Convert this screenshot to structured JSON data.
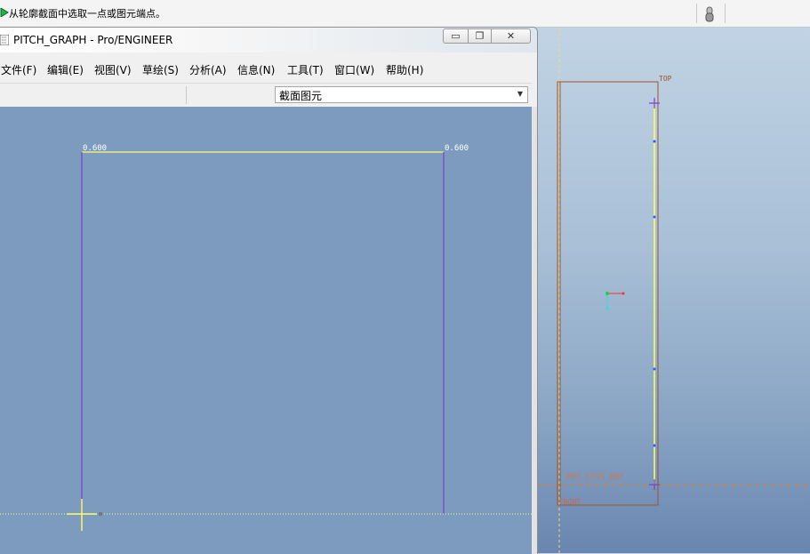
{
  "message_bar": {
    "prompt_text": "从轮廓截面中选取一点或图元端点。",
    "arrow_icon": "green-arrow-icon",
    "tool_icon": "mouse-icon"
  },
  "window": {
    "title_part1": "PITCH_GRAPH",
    "title_sep": " - ",
    "title_part2": "Pro/ENGINEER",
    "minimize_icon": "minimize-icon",
    "maximize_icon": "restore-icon",
    "close_icon": "close-icon"
  },
  "menu": [
    {
      "label": "文件(F)"
    },
    {
      "label": "编辑(E)"
    },
    {
      "label": "视图(V)"
    },
    {
      "label": "草绘(S)"
    },
    {
      "label": "分析(A)"
    },
    {
      "label": "信息(N)"
    },
    {
      "label": "工具(T)"
    },
    {
      "label": "窗口(W)"
    },
    {
      "label": "帮助(H)"
    }
  ],
  "filter": {
    "selected": "截面图元"
  },
  "sketch": {
    "dim_left": "0.600",
    "dim_right": "0.600"
  },
  "graphics": {
    "plane_label_top": "TOP",
    "csys_label": "PRT_CSYS_DEF",
    "plane_label_front": "FRONT"
  },
  "colors": {
    "sketch_bg": "#7c9bbf",
    "entity_line": "#ffff66",
    "purple_line": "#7a3fc8",
    "datum_brown": "#a0522d",
    "csys_orange": "#e07b20"
  }
}
